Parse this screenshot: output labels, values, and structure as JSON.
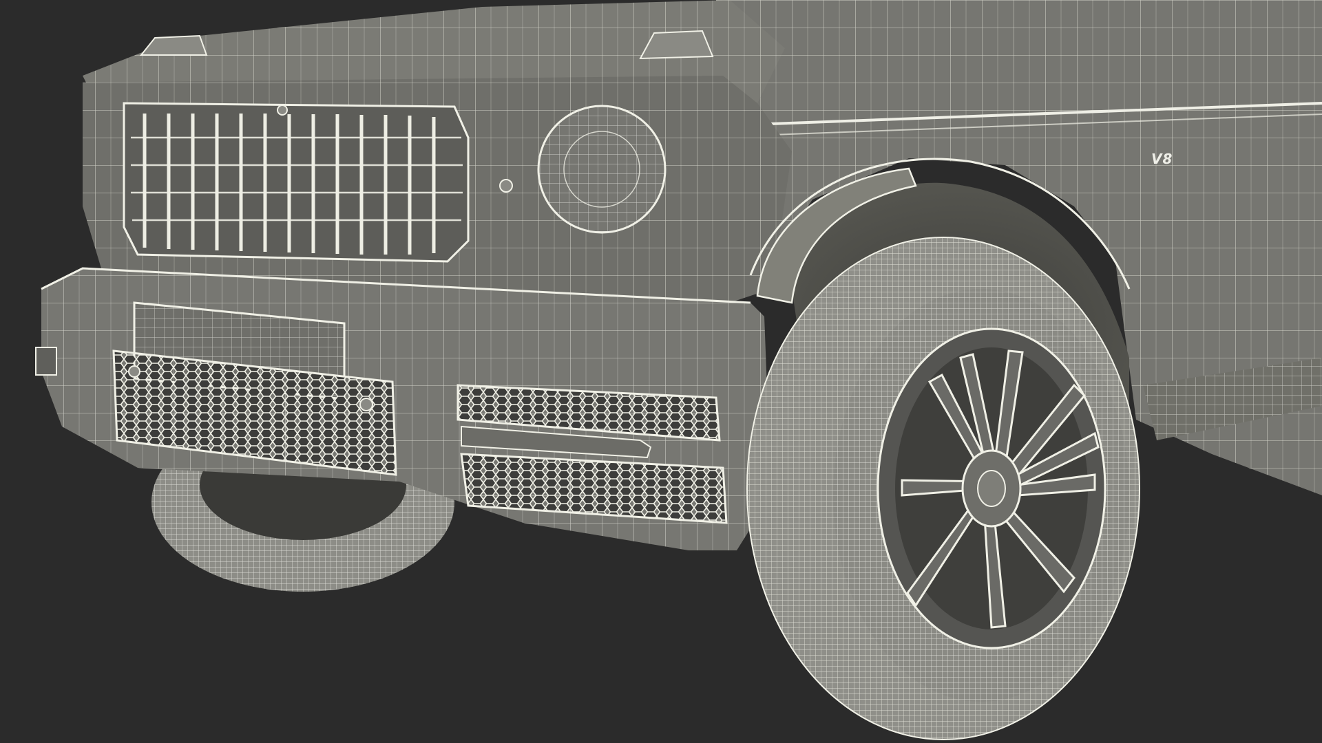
{
  "scene": {
    "badge_text": "V8",
    "colors": {
      "background": "#2b2b2b",
      "body_shade": "#6e6e6a",
      "body_light": "#8a8a84",
      "wire": "#f4f4ec",
      "tire": "#9a9a94",
      "rim": "#6a6a66"
    }
  }
}
